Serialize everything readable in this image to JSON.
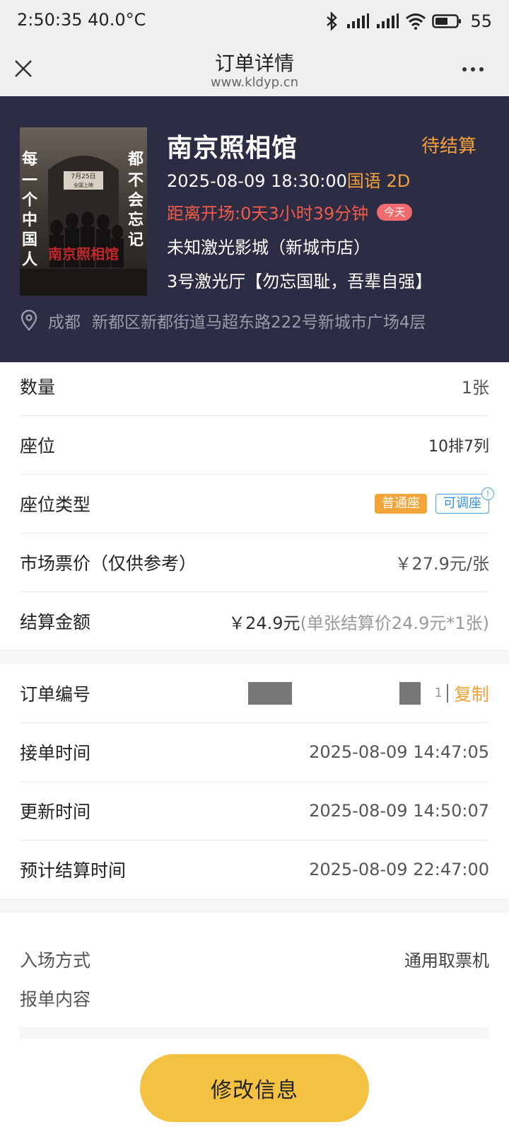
{
  "status_bar": {
    "time": "2:50:35 40.0°C",
    "battery": "55"
  },
  "header": {
    "title": "订单详情",
    "subtitle": "www.kldyp.cn"
  },
  "movie": {
    "title": "南京照相馆",
    "status": "待结算",
    "datetime": "2025-08-09 18:30:00",
    "language_format": "国语 2D",
    "countdown": "距离开场:0天3小时39分钟",
    "today_badge": "今天",
    "cinema": "未知激光影城（新城市店）",
    "hall": "3号激光厅【勿忘国耻，吾辈自强】",
    "city": "成都",
    "address": "新都区新都街道马超东路222号新城市广场4层",
    "poster": {
      "left_text": "每一个中国人",
      "right_text": "都不会忘记",
      "date_text": "7月25日",
      "release_text": "全国上映",
      "logo_text": "南京照相馆"
    }
  },
  "details": {
    "quantity": {
      "label": "数量",
      "value": "1张"
    },
    "seat": {
      "label": "座位",
      "value": "10排7列"
    },
    "seat_type": {
      "label": "座位类型",
      "tag1": "普通座",
      "tag2": "可调座",
      "info": "!"
    },
    "market_price": {
      "label": "市场票价（仅供参考）",
      "value": "￥27.9元/张"
    },
    "settlement": {
      "label": "结算金额",
      "value": "￥24.9元",
      "note": "(单张结算价24.9元*1张)"
    }
  },
  "order": {
    "order_no": {
      "label": "订单编号",
      "suffix": "1",
      "copy": "复制"
    },
    "accept_time": {
      "label": "接单时间",
      "value": "2025-08-09 14:47:05"
    },
    "update_time": {
      "label": "更新时间",
      "value": "2025-08-09 14:50:07"
    },
    "settle_time": {
      "label": "预计结算时间",
      "value": "2025-08-09 22:47:00"
    }
  },
  "entry": {
    "label": "入场方式",
    "value": "通用取票机",
    "report_label": "报单内容"
  },
  "actions": {
    "edit_button": "修改信息"
  },
  "colors": {
    "accent": "#f2a13a",
    "panel": "#2c2c44",
    "button": "#f4c242",
    "countdown": "#f05b4a"
  }
}
